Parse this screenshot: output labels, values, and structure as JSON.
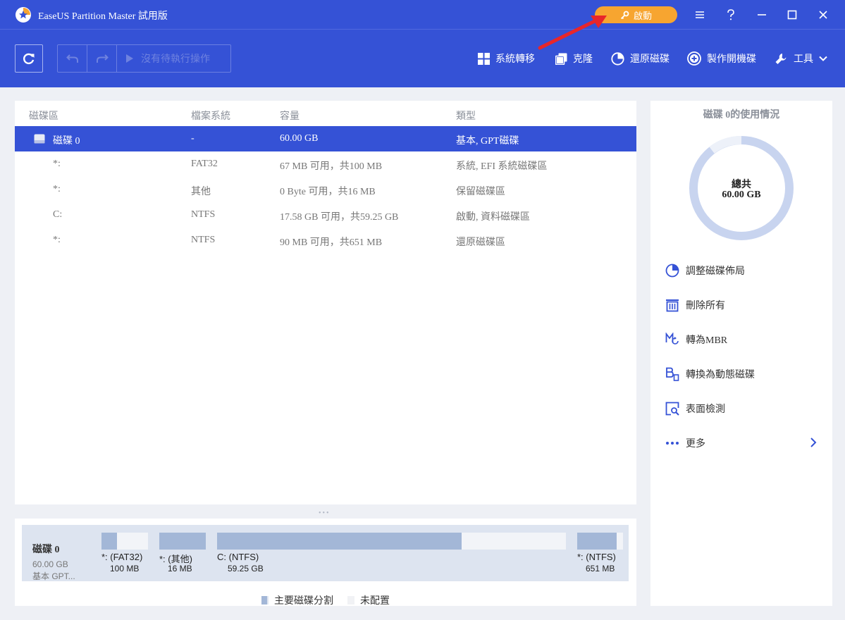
{
  "app": {
    "title": "EaseUS Partition Master 試用版",
    "activate_label": "啟動"
  },
  "toolbar": {
    "pending_label": "沒有待執行操作",
    "tools": [
      {
        "label": "系統轉移",
        "icon": "windows-icon"
      },
      {
        "label": "克隆",
        "icon": "clone-icon"
      },
      {
        "label": "還原磁碟",
        "icon": "restore-disk-icon"
      },
      {
        "label": "製作開機碟",
        "icon": "bootable-media-icon"
      },
      {
        "label": "工具",
        "icon": "tools-icon"
      }
    ]
  },
  "table": {
    "headers": [
      "磁碟區",
      "檔案系統",
      "容量",
      "類型"
    ],
    "rows": [
      {
        "name": "磁碟 0",
        "fs": "-",
        "capacity": "60.00 GB",
        "type": "基本, GPT磁碟",
        "selected": true
      },
      {
        "name": "*:",
        "fs": "FAT32",
        "capacity": "67 MB 可用，共100 MB",
        "type": "系統, EFI 系統磁碟區"
      },
      {
        "name": "*:",
        "fs": "其他",
        "capacity": "0 Byte 可用，共16 MB",
        "type": "保留磁碟區"
      },
      {
        "name": "C:",
        "fs": "NTFS",
        "capacity": "17.58 GB 可用，共59.25 GB",
        "type": "啟動, 資料磁碟區"
      },
      {
        "name": "*:",
        "fs": "NTFS",
        "capacity": "90 MB 可用，共651 MB",
        "type": "還原磁碟區"
      }
    ]
  },
  "disk_map": {
    "disk_name": "磁碟 0",
    "disk_size": "60.00 GB",
    "disk_type": "基本 GPT...",
    "partitions": [
      {
        "label": "*: (FAT32)",
        "size": "100 MB",
        "used_fraction": 0.33
      },
      {
        "label": "*: (其他)",
        "size": "16 MB",
        "used_fraction": 1.0
      },
      {
        "label": "C: (NTFS)",
        "size": "59.25 GB",
        "used_fraction": 0.7
      },
      {
        "label": "*: (NTFS)",
        "size": "651 MB",
        "used_fraction": 0.86
      }
    ],
    "legend": {
      "primary": "主要磁碟分割",
      "unallocated": "未配置"
    }
  },
  "usage": {
    "title": "磁碟 0的使用情況",
    "total_label": "總共",
    "total_value": "60.00 GB",
    "actions": [
      {
        "label": "調整磁碟佈局",
        "icon": "pie-layout-icon"
      },
      {
        "label": "刪除所有",
        "icon": "delete-all-icon"
      },
      {
        "label": "轉為MBR",
        "icon": "convert-mbr-icon"
      },
      {
        "label": "轉換為動態磁碟",
        "icon": "convert-dynamic-icon"
      },
      {
        "label": "表面檢測",
        "icon": "surface-test-icon"
      },
      {
        "label": "更多",
        "icon": "more-dots-icon"
      }
    ]
  },
  "colors": {
    "brand": "#3552d6",
    "accent": "#f7a530",
    "partition": "#a3b7d7",
    "annotation_arrow": "#e8262a"
  }
}
